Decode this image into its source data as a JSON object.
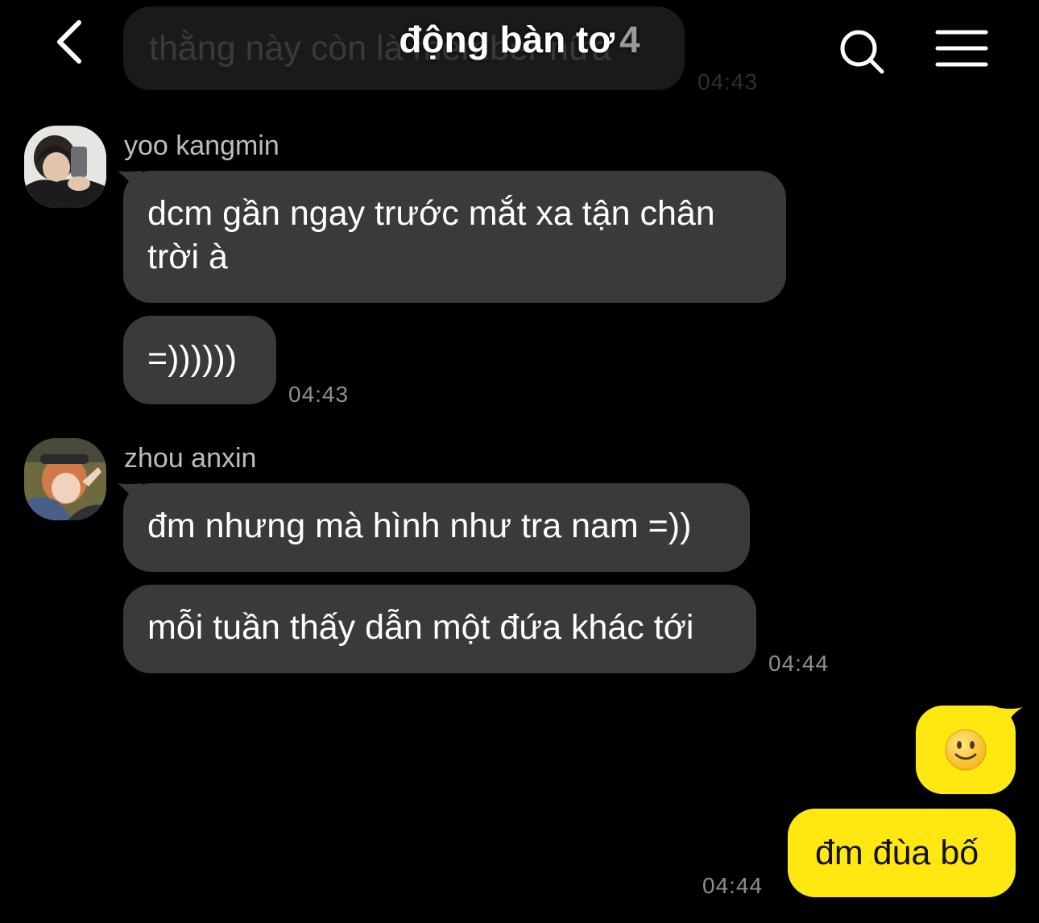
{
  "header": {
    "title": "động bàn tơ",
    "member_count": "4"
  },
  "previous": {
    "text": "thằng này còn là member nữa",
    "time": "04:43"
  },
  "messages": [
    {
      "sender": "yoo kangmin",
      "bubbles": [
        "dcm gần ngay trước mắt xa tận chân trời à",
        "=))))))"
      ],
      "time": "04:43"
    },
    {
      "sender": "zhou anxin",
      "bubbles": [
        "đm nhưng mà hình như tra nam =))",
        "mỗi tuần thấy dẫn một đứa khác tới"
      ],
      "time": "04:44"
    }
  ],
  "outgoing": {
    "emoji": "🙂",
    "text": "đm đùa bố",
    "time": "04:44"
  },
  "colors": {
    "background": "#000000",
    "incoming_bubble": "#3a3a3c",
    "outgoing_bubble": "#ffe812",
    "timestamp": "#8e8e8e",
    "sender_name": "#bdbdbd"
  }
}
